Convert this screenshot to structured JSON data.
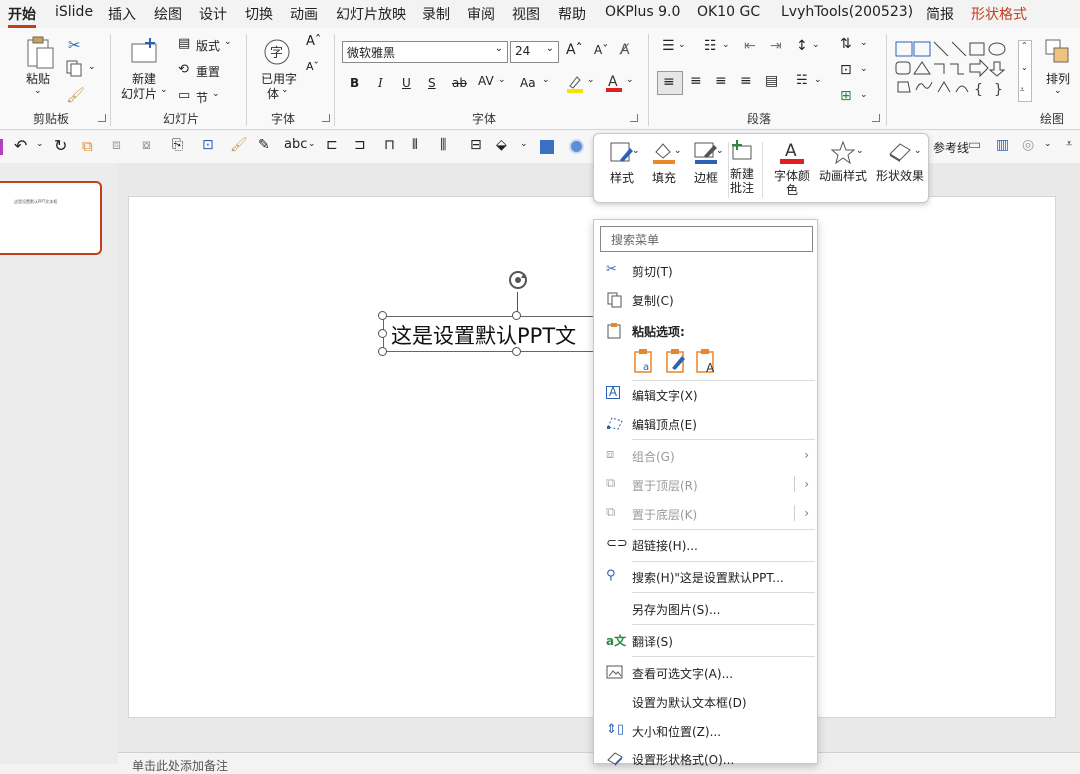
{
  "tabs": [
    "开始",
    "iSlide",
    "插入",
    "绘图",
    "设计",
    "切换",
    "动画",
    "幻灯片放映",
    "录制",
    "审阅",
    "视图",
    "帮助",
    "OKPlus 9.0",
    "OK10 GC",
    "LvyhTools(200523)",
    "简报",
    "形状格式"
  ],
  "ribbon": {
    "clipboard": {
      "paste": "粘贴",
      "group": "剪贴板"
    },
    "slides": {
      "new_line1": "新建",
      "new_line2": "幻灯片",
      "layout": "版式",
      "reset": "重置",
      "section": "节",
      "group": "幻灯片"
    },
    "fonts_btn": {
      "line1": "已用字",
      "line2": "体",
      "group": "字体"
    },
    "font": {
      "name": "微软雅黑",
      "size": "24",
      "bold": "B",
      "italic": "I",
      "underline": "U",
      "shadow": "S",
      "strike": "ab",
      "spacing": "AV",
      "case": "Aa",
      "group": "字体"
    },
    "paragraph": {
      "group": "段落"
    },
    "drawing": {
      "arrange": "排列",
      "group": "绘图"
    }
  },
  "qat": {
    "gridlines": "参考线"
  },
  "slide": {
    "text": "这是设置默认PPT文"
  },
  "thumbnail": {
    "text": "这是设置默认PPT文本框"
  },
  "notes": {
    "placeholder": "单击此处添加备注"
  },
  "minibar": {
    "style": "样式",
    "fill": "填充",
    "border": "边框",
    "new_comment_1": "新建",
    "new_comment_2": "批注",
    "font_color_1": "字体颜",
    "font_color_2": "色",
    "anim": "动画样式",
    "shape_effect": "形状效果"
  },
  "context_menu": {
    "search_placeholder": "搜索菜单",
    "items": [
      {
        "label": "剪切(T)"
      },
      {
        "label": "复制(C)"
      },
      {
        "label": "粘贴选项:"
      },
      {
        "label": "编辑文字(X)"
      },
      {
        "label": "编辑顶点(E)"
      },
      {
        "label": "组合(G)"
      },
      {
        "label": "置于顶层(R)"
      },
      {
        "label": "置于底层(K)"
      },
      {
        "label": "超链接(H)..."
      },
      {
        "label": "搜索(H)\"这是设置默认PPT..."
      },
      {
        "label": "另存为图片(S)..."
      },
      {
        "label": "翻译(S)"
      },
      {
        "label": "查看可选文字(A)..."
      },
      {
        "label": "设置为默认文本框(D)"
      },
      {
        "label": "大小和位置(Z)..."
      },
      {
        "label": "设置形状格式(O)..."
      }
    ]
  },
  "colors": {
    "accent": "#c43e1c",
    "font_red": "#e02020",
    "highlight_yellow": "#f5e400",
    "icon_blue": "#2b62b8",
    "icon_orange": "#e8862a"
  }
}
